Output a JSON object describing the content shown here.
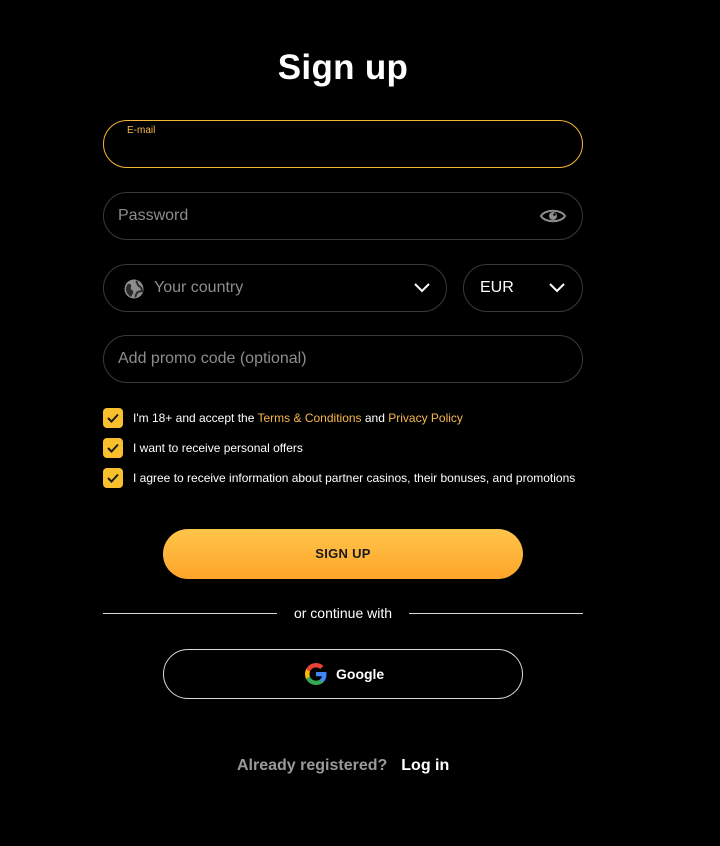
{
  "title": "Sign up",
  "email": {
    "label": "E-mail",
    "value": ""
  },
  "password": {
    "placeholder": "Password",
    "icon": "eye-icon"
  },
  "country": {
    "placeholder": "Your country",
    "icon": "globe-icon"
  },
  "currency": {
    "value": "EUR"
  },
  "promo": {
    "placeholder": "Add promo code (optional)"
  },
  "consents": {
    "age": {
      "prefix": "I'm 18+ and accept the ",
      "terms_link": "Terms & Conditions",
      "middle": " and ",
      "privacy_link": "Privacy Policy",
      "checked": true
    },
    "offers": {
      "label": "I want to receive personal offers",
      "checked": true
    },
    "partners": {
      "label": "I agree to receive information about partner casinos, their bonuses, and promotions",
      "checked": true
    }
  },
  "signup_button": "SIGN UP",
  "divider_text": "or continue with",
  "google_button": "Google",
  "footer": {
    "question": "Already registered?",
    "login_link": "Log in"
  },
  "colors": {
    "accent": "#f7b84b",
    "button_top": "#ffc54a",
    "button_bottom": "#fea52a",
    "checkbox": "#f9c02d",
    "background": "#000000"
  }
}
